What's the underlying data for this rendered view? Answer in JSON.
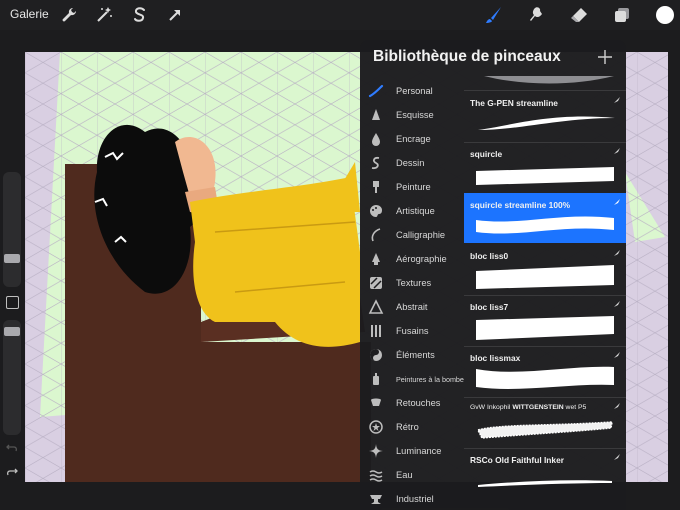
{
  "topbar": {
    "gallery_label": "Galerie",
    "left_icons": [
      "wrench-icon",
      "magic-wand-icon",
      "selection-s-icon",
      "move-arrow-icon"
    ],
    "right_icons": [
      "brush-icon",
      "smudge-icon",
      "eraser-icon",
      "layers-icon",
      "color-swatch-icon"
    ],
    "active_color": "#ffffff",
    "active_tool_color": "#2f7cff"
  },
  "panel": {
    "title": "Bibliothèque de pinceaux",
    "add_icon": "plus-icon",
    "categories": [
      {
        "label": "Personal",
        "icon": "personal-brush-icon",
        "active": true
      },
      {
        "label": "Esquisse",
        "icon": "sketch-icon"
      },
      {
        "label": "Encrage",
        "icon": "ink-drop-icon"
      },
      {
        "label": "Dessin",
        "icon": "drawing-curve-icon"
      },
      {
        "label": "Peinture",
        "icon": "paint-brush-icon"
      },
      {
        "label": "Artistique",
        "icon": "palette-icon"
      },
      {
        "label": "Calligraphie",
        "icon": "calligraphy-icon"
      },
      {
        "label": "Aérographie",
        "icon": "airbrush-icon"
      },
      {
        "label": "Textures",
        "icon": "texture-icon"
      },
      {
        "label": "Abstrait",
        "icon": "triangle-icon"
      },
      {
        "label": "Fusains",
        "icon": "charcoal-icon"
      },
      {
        "label": "Éléments",
        "icon": "yin-yang-icon"
      },
      {
        "label": "Peintures à la bombe",
        "icon": "spray-can-icon"
      },
      {
        "label": "Retouches",
        "icon": "retouch-icon"
      },
      {
        "label": "Rétro",
        "icon": "retro-star-icon"
      },
      {
        "label": "Luminance",
        "icon": "sparkle-icon"
      },
      {
        "label": "Eau",
        "icon": "water-waves-icon"
      },
      {
        "label": "Industriel",
        "icon": "anvil-icon"
      }
    ],
    "brushes": [
      {
        "name": "The G-PEN streamline",
        "style": "taper",
        "selected": false
      },
      {
        "name": "squircle",
        "style": "flat",
        "selected": false
      },
      {
        "name": "squircle streamline 100%",
        "style": "wave",
        "selected": true
      },
      {
        "name": "bloc liss0",
        "style": "flat",
        "selected": false
      },
      {
        "name": "bloc liss7",
        "style": "thick",
        "selected": false
      },
      {
        "name": "bloc lissmax",
        "style": "thick-wave",
        "selected": false
      },
      {
        "name_prefix": "GvW Inkophil ",
        "name_bold": "WITTGENSTEIN",
        "name_suffix": " wet P5",
        "style": "rough",
        "selected": false
      },
      {
        "name": "RSCo Old Faithful Inker",
        "style": "thin",
        "selected": false
      }
    ]
  },
  "colors": {
    "canvas_bg": "#d9cfe2",
    "green_highlight": "#dbf7cf",
    "chair": "#4f2a1e",
    "hoodie": "#f0c21b",
    "skin": "#f1b891",
    "selected_brush": "#1c74ff"
  }
}
